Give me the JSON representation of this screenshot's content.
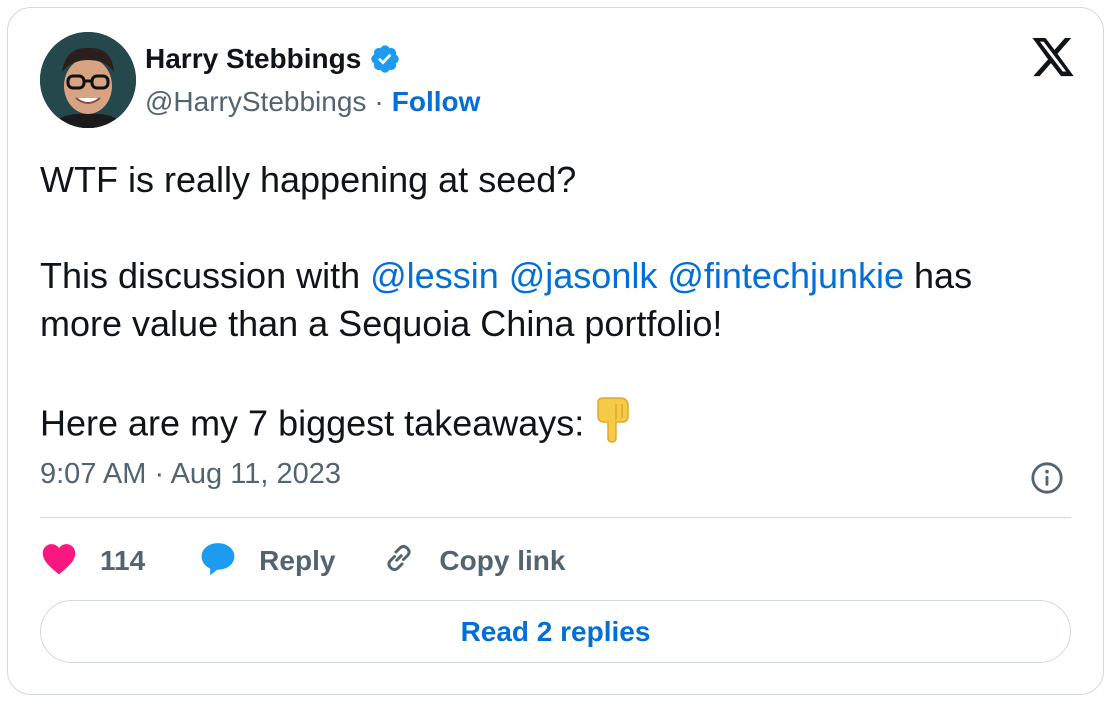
{
  "author": {
    "name": "Harry Stebbings",
    "handle": "@HarryStebbings",
    "separator": "·",
    "follow_label": "Follow"
  },
  "tweet": {
    "line1": "WTF is really happening at seed?",
    "line2_prefix": "This discussion with ",
    "mentions": [
      "@lessin",
      "@jasonlk",
      "@fintechjunkie"
    ],
    "line2_suffix": " has",
    "line3": "more value than a Sequoia China portfolio!",
    "line4": "Here are my 7 biggest takeaways:",
    "emoji": "backhand-index-pointing-down-emoji"
  },
  "meta": {
    "timestamp": "9:07 AM · Aug 11, 2023"
  },
  "actions": {
    "like_count": "114",
    "reply_label": "Reply",
    "copy_label": "Copy link"
  },
  "read_replies_label": "Read 2 replies",
  "colors": {
    "link_blue": "#006fd6",
    "verified_blue": "#1d9bf0",
    "heart_pink": "#f91880",
    "text_gray": "#536471",
    "border": "#cfd9de"
  },
  "icons": [
    "verified-badge-icon",
    "x-logo-icon",
    "info-icon",
    "heart-icon",
    "reply-bubble-icon",
    "link-icon"
  ]
}
